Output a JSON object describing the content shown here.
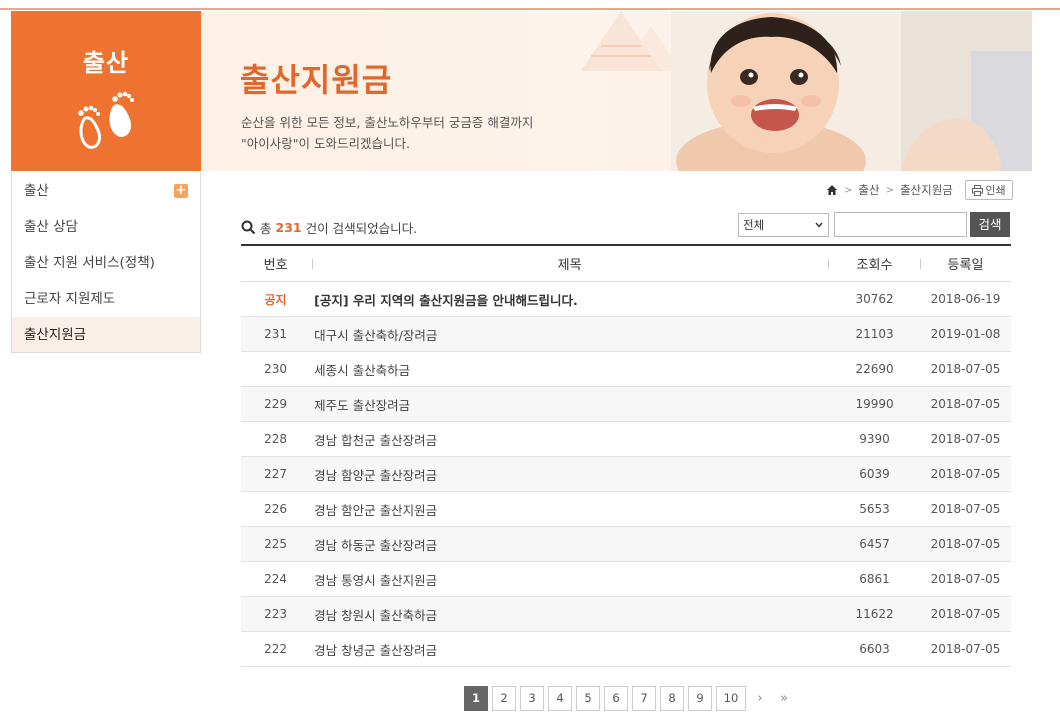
{
  "side_header": {
    "title": "출산"
  },
  "banner": {
    "title": "출산지원금",
    "desc_line1": "순산을 위한 모든 정보, 출산노하우부터 궁금증 해결까지",
    "desc_line2": "\"아이사랑\"이 도와드리겠습니다."
  },
  "menu": {
    "items": [
      {
        "label": "출산"
      },
      {
        "label": "출산 상담"
      },
      {
        "label": "출산 지원 서비스(정책)"
      },
      {
        "label": "근로자 지원제도"
      },
      {
        "label": "출산지원금"
      }
    ],
    "plus": "+"
  },
  "breadcrumb": {
    "level1": "출산",
    "level2": "출산지원금",
    "sep": ">"
  },
  "print_label": "인쇄",
  "search": {
    "prefix": "총",
    "count": "231",
    "suffix": "건이 검색되었습니다.",
    "select_value": "전체",
    "button": "검색"
  },
  "table": {
    "headers": {
      "no": "번호",
      "title": "제목",
      "views": "조회수",
      "date": "등록일"
    },
    "rows": [
      {
        "no": "공지",
        "title": "[공지] 우리 지역의 출산지원금을 안내해드립니다.",
        "views": "30762",
        "date": "2018-06-19"
      },
      {
        "no": "231",
        "title": "대구시 출산축하/장려금",
        "views": "21103",
        "date": "2019-01-08"
      },
      {
        "no": "230",
        "title": "세종시 출산축하금",
        "views": "22690",
        "date": "2018-07-05"
      },
      {
        "no": "229",
        "title": "제주도 출산장려금",
        "views": "19990",
        "date": "2018-07-05"
      },
      {
        "no": "228",
        "title": "경남 합천군 출산장려금",
        "views": "9390",
        "date": "2018-07-05"
      },
      {
        "no": "227",
        "title": "경남 함양군 출산장려금",
        "views": "6039",
        "date": "2018-07-05"
      },
      {
        "no": "226",
        "title": "경남 함안군 출산지원금",
        "views": "5653",
        "date": "2018-07-05"
      },
      {
        "no": "225",
        "title": "경남 하동군 출산장려금",
        "views": "6457",
        "date": "2018-07-05"
      },
      {
        "no": "224",
        "title": "경남 통영시 출산지원금",
        "views": "6861",
        "date": "2018-07-05"
      },
      {
        "no": "223",
        "title": "경남 창원시 출산축하금",
        "views": "11622",
        "date": "2018-07-05"
      },
      {
        "no": "222",
        "title": "경남 창녕군 출산장려금",
        "views": "6603",
        "date": "2018-07-05"
      }
    ]
  },
  "pagination": {
    "pages": [
      "1",
      "2",
      "3",
      "4",
      "5",
      "6",
      "7",
      "8",
      "9",
      "10"
    ],
    "current": "1",
    "next": "›",
    "last": "»"
  },
  "colors": {
    "accent": "#ee7330",
    "title": "#e2672c"
  }
}
